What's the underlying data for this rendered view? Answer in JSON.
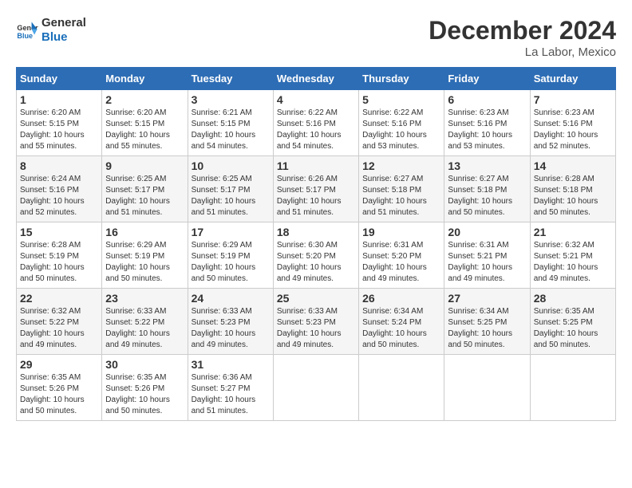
{
  "logo": {
    "line1": "General",
    "line2": "Blue"
  },
  "title": "December 2024",
  "location": "La Labor, Mexico",
  "days_of_week": [
    "Sunday",
    "Monday",
    "Tuesday",
    "Wednesday",
    "Thursday",
    "Friday",
    "Saturday"
  ],
  "weeks": [
    [
      {
        "day": "1",
        "info": "Sunrise: 6:20 AM\nSunset: 5:15 PM\nDaylight: 10 hours\nand 55 minutes."
      },
      {
        "day": "2",
        "info": "Sunrise: 6:20 AM\nSunset: 5:15 PM\nDaylight: 10 hours\nand 55 minutes."
      },
      {
        "day": "3",
        "info": "Sunrise: 6:21 AM\nSunset: 5:15 PM\nDaylight: 10 hours\nand 54 minutes."
      },
      {
        "day": "4",
        "info": "Sunrise: 6:22 AM\nSunset: 5:16 PM\nDaylight: 10 hours\nand 54 minutes."
      },
      {
        "day": "5",
        "info": "Sunrise: 6:22 AM\nSunset: 5:16 PM\nDaylight: 10 hours\nand 53 minutes."
      },
      {
        "day": "6",
        "info": "Sunrise: 6:23 AM\nSunset: 5:16 PM\nDaylight: 10 hours\nand 53 minutes."
      },
      {
        "day": "7",
        "info": "Sunrise: 6:23 AM\nSunset: 5:16 PM\nDaylight: 10 hours\nand 52 minutes."
      }
    ],
    [
      {
        "day": "8",
        "info": "Sunrise: 6:24 AM\nSunset: 5:16 PM\nDaylight: 10 hours\nand 52 minutes."
      },
      {
        "day": "9",
        "info": "Sunrise: 6:25 AM\nSunset: 5:17 PM\nDaylight: 10 hours\nand 51 minutes."
      },
      {
        "day": "10",
        "info": "Sunrise: 6:25 AM\nSunset: 5:17 PM\nDaylight: 10 hours\nand 51 minutes."
      },
      {
        "day": "11",
        "info": "Sunrise: 6:26 AM\nSunset: 5:17 PM\nDaylight: 10 hours\nand 51 minutes."
      },
      {
        "day": "12",
        "info": "Sunrise: 6:27 AM\nSunset: 5:18 PM\nDaylight: 10 hours\nand 51 minutes."
      },
      {
        "day": "13",
        "info": "Sunrise: 6:27 AM\nSunset: 5:18 PM\nDaylight: 10 hours\nand 50 minutes."
      },
      {
        "day": "14",
        "info": "Sunrise: 6:28 AM\nSunset: 5:18 PM\nDaylight: 10 hours\nand 50 minutes."
      }
    ],
    [
      {
        "day": "15",
        "info": "Sunrise: 6:28 AM\nSunset: 5:19 PM\nDaylight: 10 hours\nand 50 minutes."
      },
      {
        "day": "16",
        "info": "Sunrise: 6:29 AM\nSunset: 5:19 PM\nDaylight: 10 hours\nand 50 minutes."
      },
      {
        "day": "17",
        "info": "Sunrise: 6:29 AM\nSunset: 5:19 PM\nDaylight: 10 hours\nand 50 minutes."
      },
      {
        "day": "18",
        "info": "Sunrise: 6:30 AM\nSunset: 5:20 PM\nDaylight: 10 hours\nand 49 minutes."
      },
      {
        "day": "19",
        "info": "Sunrise: 6:31 AM\nSunset: 5:20 PM\nDaylight: 10 hours\nand 49 minutes."
      },
      {
        "day": "20",
        "info": "Sunrise: 6:31 AM\nSunset: 5:21 PM\nDaylight: 10 hours\nand 49 minutes."
      },
      {
        "day": "21",
        "info": "Sunrise: 6:32 AM\nSunset: 5:21 PM\nDaylight: 10 hours\nand 49 minutes."
      }
    ],
    [
      {
        "day": "22",
        "info": "Sunrise: 6:32 AM\nSunset: 5:22 PM\nDaylight: 10 hours\nand 49 minutes."
      },
      {
        "day": "23",
        "info": "Sunrise: 6:33 AM\nSunset: 5:22 PM\nDaylight: 10 hours\nand 49 minutes."
      },
      {
        "day": "24",
        "info": "Sunrise: 6:33 AM\nSunset: 5:23 PM\nDaylight: 10 hours\nand 49 minutes."
      },
      {
        "day": "25",
        "info": "Sunrise: 6:33 AM\nSunset: 5:23 PM\nDaylight: 10 hours\nand 49 minutes."
      },
      {
        "day": "26",
        "info": "Sunrise: 6:34 AM\nSunset: 5:24 PM\nDaylight: 10 hours\nand 50 minutes."
      },
      {
        "day": "27",
        "info": "Sunrise: 6:34 AM\nSunset: 5:25 PM\nDaylight: 10 hours\nand 50 minutes."
      },
      {
        "day": "28",
        "info": "Sunrise: 6:35 AM\nSunset: 5:25 PM\nDaylight: 10 hours\nand 50 minutes."
      }
    ],
    [
      {
        "day": "29",
        "info": "Sunrise: 6:35 AM\nSunset: 5:26 PM\nDaylight: 10 hours\nand 50 minutes."
      },
      {
        "day": "30",
        "info": "Sunrise: 6:35 AM\nSunset: 5:26 PM\nDaylight: 10 hours\nand 50 minutes."
      },
      {
        "day": "31",
        "info": "Sunrise: 6:36 AM\nSunset: 5:27 PM\nDaylight: 10 hours\nand 51 minutes."
      },
      {
        "day": "",
        "info": ""
      },
      {
        "day": "",
        "info": ""
      },
      {
        "day": "",
        "info": ""
      },
      {
        "day": "",
        "info": ""
      }
    ]
  ]
}
